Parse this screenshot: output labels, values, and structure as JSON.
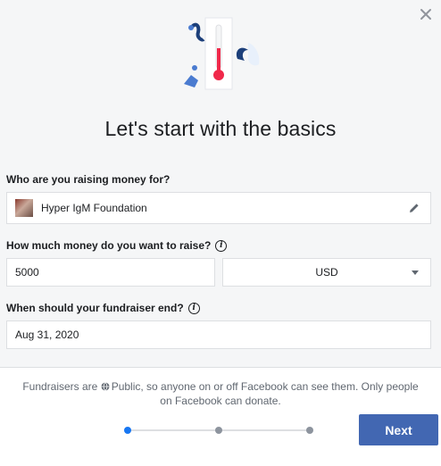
{
  "dialog": {
    "close_icon": "close-icon",
    "illustration": "thermometer-illustration",
    "title": "Let's start with the basics"
  },
  "beneficiary": {
    "label": "Who are you raising money for?",
    "value": "Hyper IgM Foundation",
    "edit_icon": "pencil-icon"
  },
  "goal": {
    "label": "How much money do you want to raise?",
    "amount": "5000",
    "currency": "USD",
    "info_icon": "info-icon"
  },
  "end_date": {
    "label": "When should your fundraiser end?",
    "value": "Aug 31, 2020",
    "info_icon": "info-icon"
  },
  "footer": {
    "note_before": "Fundraisers are ",
    "note_after": "Public, so anyone on or off Facebook can see them. Only people on Facebook can donate.",
    "globe_icon": "globe-icon",
    "steps_total": 3,
    "current_step": 1,
    "next_label": "Next"
  },
  "colors": {
    "primary_button": "#4267b2",
    "active_step": "#1877f2",
    "inactive_step": "#8d949e",
    "thermometer": "#f0284a"
  }
}
